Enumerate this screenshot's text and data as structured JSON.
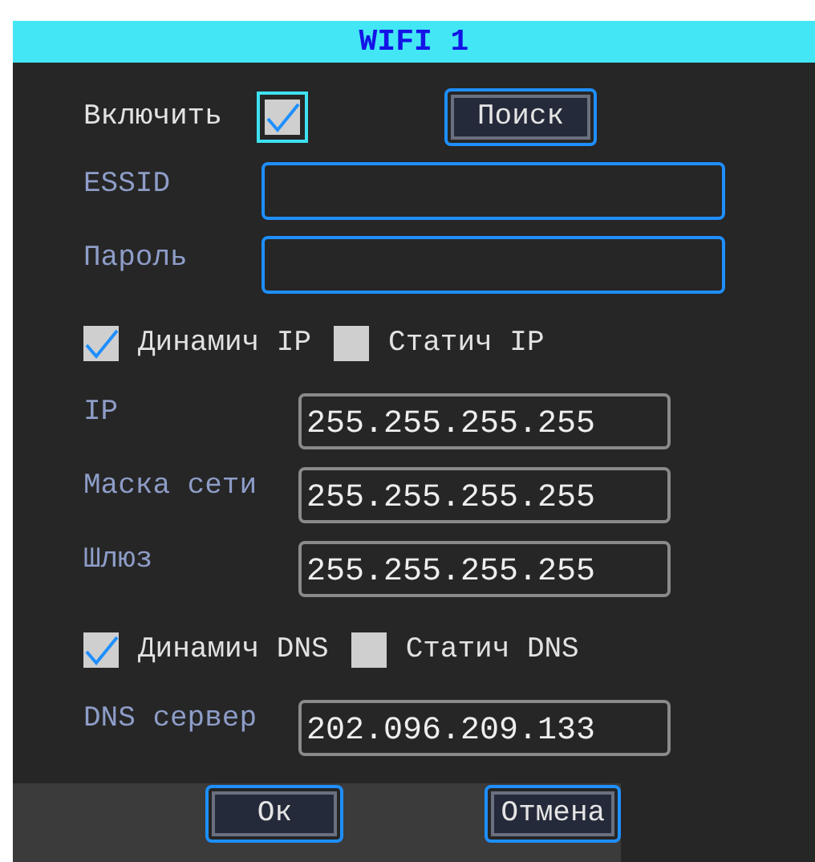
{
  "window": {
    "title": "WIFI 1"
  },
  "enable": {
    "label": "Включить",
    "checked": true,
    "focused": true
  },
  "search_button": {
    "label": "Поиск"
  },
  "fields": [
    {
      "label": "ESSID"
    },
    {
      "label": "Пароль"
    }
  ],
  "ip_mode": [
    {
      "label": "Динамич IP",
      "checked": true
    },
    {
      "label": "Статич IP",
      "checked": false
    }
  ],
  "ip_fields": [
    {
      "label": "IP",
      "value": "255.255.255.255"
    },
    {
      "label": "Маска сети",
      "value": "255.255.255.255"
    },
    {
      "label": "Шлюз",
      "value": "255.255.255.255"
    }
  ],
  "dns_mode": [
    {
      "label": "Динамич DNS",
      "checked": true
    },
    {
      "label": "Статич DNS",
      "checked": false
    }
  ],
  "dns_fields": [
    {
      "label": "DNS сервер",
      "value": "202.096.209.133"
    }
  ],
  "buttons": [
    {
      "label": "Ок"
    },
    {
      "label": "Отмена"
    }
  ]
}
